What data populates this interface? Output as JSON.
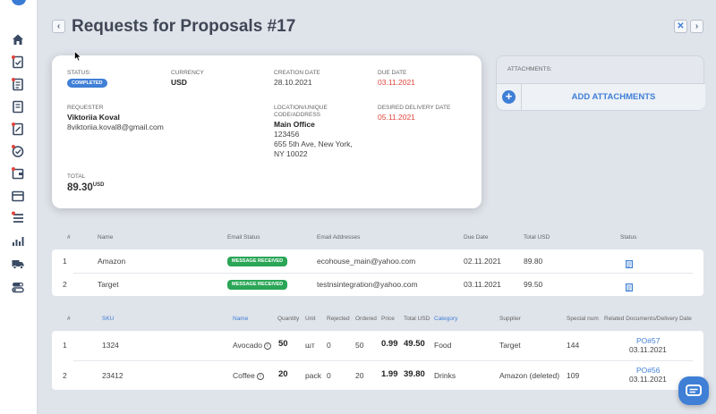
{
  "page": {
    "title": "Requests for Proposals #17"
  },
  "details": {
    "status_label": "STATUS:",
    "status_value": "COMPLETED",
    "currency_label": "CURRENCY",
    "currency_value": "USD",
    "creation_date_label": "CREATION DATE",
    "creation_date_value": "28.10.2021",
    "due_date_label": "DUE DATE",
    "due_date_value": "03.11.2021",
    "requester_label": "REQUESTER",
    "requester_name": "Viktoriia Koval",
    "requester_email": "8viktoriia.koval8@gmail.com",
    "location_label_1": "LOCATION/UNIQUE",
    "location_label_2": "CODE/ADDRESS",
    "location_name": "Main Office",
    "location_code": "123456",
    "location_address_1": "655 5th Ave, New York,",
    "location_address_2": "NY 10022",
    "delivery_date_label": "DESIRED DELIVERY DATE",
    "delivery_date_value": "05.11.2021",
    "total_label": "TOTAL",
    "total_value": "89.30",
    "total_currency": "USD"
  },
  "attachments": {
    "label": "ATTACHMENTS:",
    "add_button": "ADD ATTACHMENTS",
    "plus": "+"
  },
  "suppliers_table": {
    "headers": {
      "num": "#",
      "name": "Name",
      "email_status": "Email Status",
      "email_addresses": "Email Addresses",
      "due_date": "Due Date",
      "total_usd": "Total USD",
      "status": "Status"
    },
    "rows": [
      {
        "num": "1",
        "name": "Amazon",
        "email_status": "MESSAGE RECEIVED",
        "email": "ecohouse_main@yahoo.com",
        "due_date": "02.11.2021",
        "total": "89.80"
      },
      {
        "num": "2",
        "name": "Target",
        "email_status": "MESSAGE RECEIVED",
        "email": "testnsintegration@yahoo.com",
        "due_date": "03.11.2021",
        "total": "99.50"
      }
    ]
  },
  "items_table": {
    "headers": {
      "num": "#",
      "sku": "SKU",
      "name": "Name",
      "quantity": "Quantity",
      "unit": "Unit",
      "rejected": "Rejected",
      "ordered": "Ordered",
      "price": "Price",
      "total_usd": "Total USD",
      "category": "Category",
      "supplier": "Supplier",
      "special_num": "Special num",
      "related": "Related Documents/Delivery Date"
    },
    "rows": [
      {
        "num": "1",
        "sku": "1324",
        "name": "Avocado",
        "quantity": "50",
        "unit": "шт",
        "rejected": "0",
        "ordered": "50",
        "price": "0.99",
        "total": "49.50",
        "category": "Food",
        "supplier": "Target",
        "special_num": "144",
        "related_doc": "PO#57",
        "related_date": "03.11.2021"
      },
      {
        "num": "2",
        "sku": "23412",
        "name": "Coffee",
        "quantity": "20",
        "unit": "pack",
        "rejected": "0",
        "ordered": "20",
        "price": "1.99",
        "total": "39.80",
        "category": "Drinks",
        "supplier": "Amazon (deleted)",
        "special_num": "109",
        "related_doc": "PO#56",
        "related_date": "03.11.2021"
      }
    ]
  },
  "colors": {
    "accent": "#3f7fd6",
    "success": "#2aa656",
    "danger": "#e0453c",
    "sidebar_icon": "#3a4a63",
    "sidebar_dot": "#e0453c"
  },
  "icons": {
    "back": "chevron-left-icon",
    "close": "close-icon",
    "forward": "chevron-right-icon"
  }
}
